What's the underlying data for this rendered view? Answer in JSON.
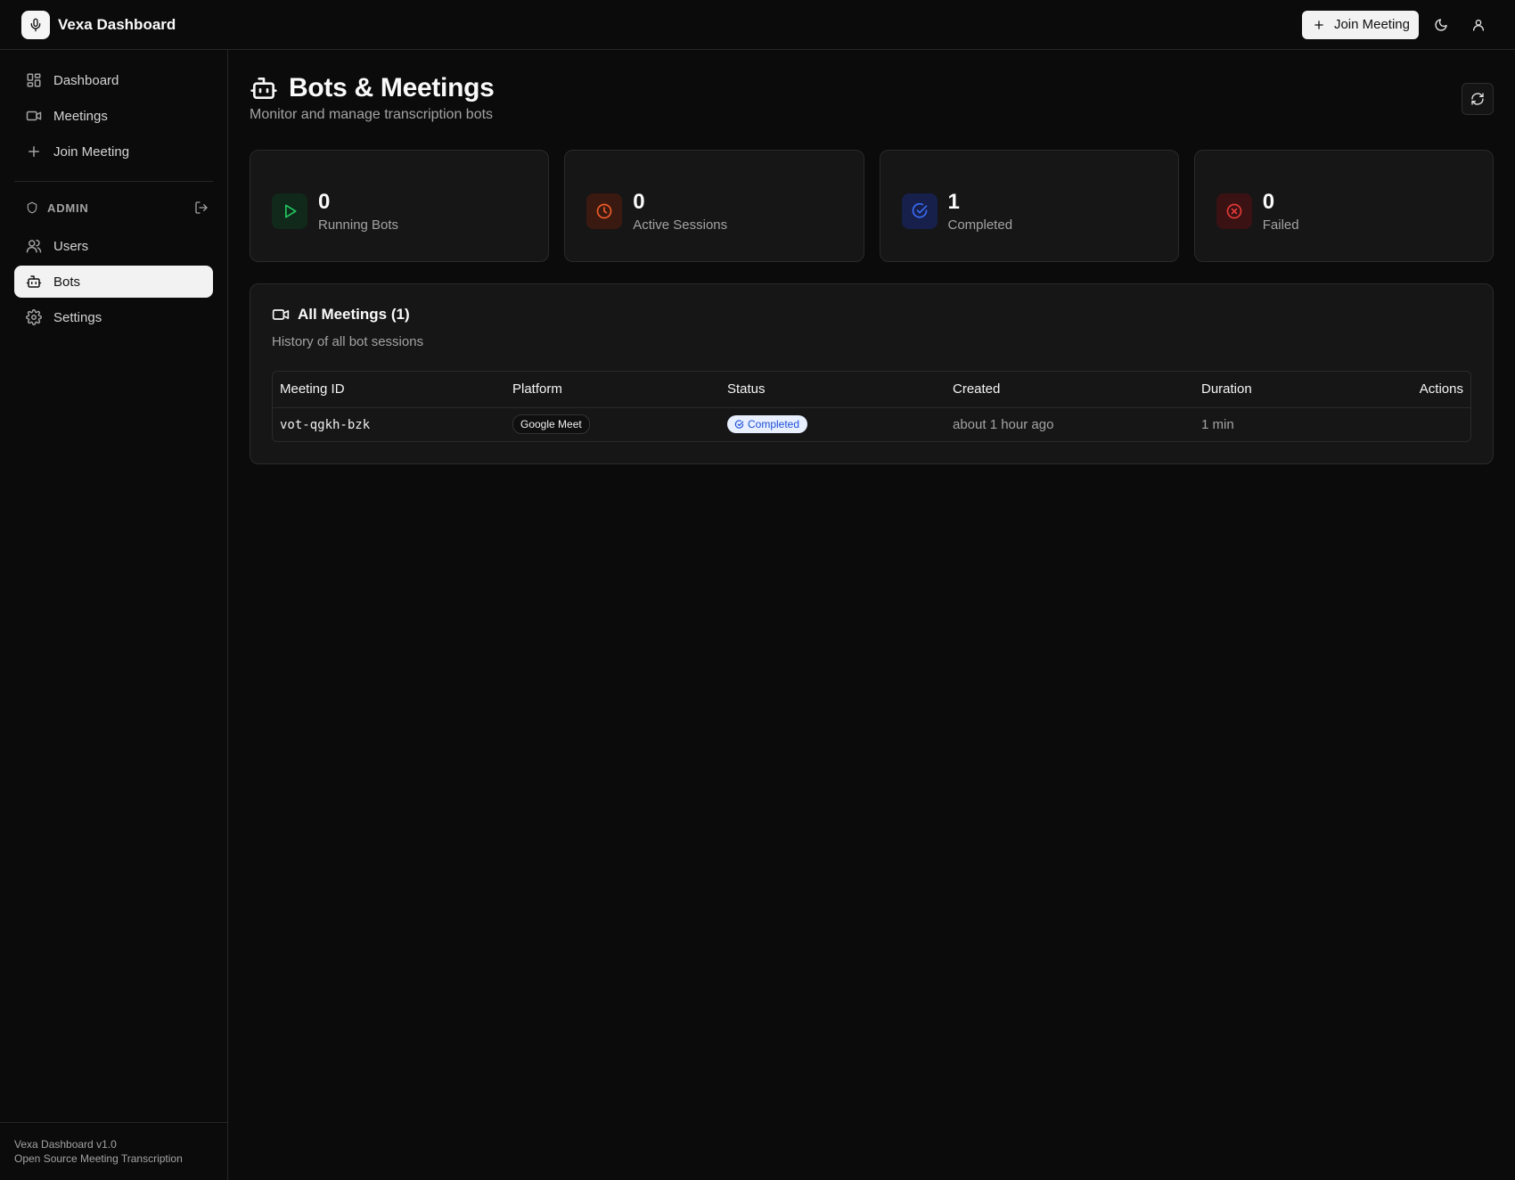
{
  "app": {
    "title": "Vexa Dashboard"
  },
  "header": {
    "join_label": "Join Meeting",
    "theme_icon": "moon-icon",
    "user_icon": "user-icon"
  },
  "sidebar": {
    "items": [
      {
        "label": "Dashboard",
        "icon": "dashboard-icon"
      },
      {
        "label": "Meetings",
        "icon": "video-icon"
      },
      {
        "label": "Join Meeting",
        "icon": "plus-icon"
      }
    ],
    "admin_label": "ADMIN",
    "admin_items": [
      {
        "label": "Users",
        "icon": "users-icon"
      },
      {
        "label": "Bots",
        "icon": "bot-icon",
        "active": true
      },
      {
        "label": "Settings",
        "icon": "gear-icon"
      }
    ],
    "footer_version": "Vexa Dashboard v1.0",
    "footer_tagline": "Open Source Meeting Transcription"
  },
  "page": {
    "title": "Bots & Meetings",
    "subtitle": "Monitor and manage transcription bots"
  },
  "stats": [
    {
      "value": "0",
      "label": "Running Bots",
      "color": "#22c55e"
    },
    {
      "value": "0",
      "label": "Active Sessions",
      "color": "#f05a28"
    },
    {
      "value": "1",
      "label": "Completed",
      "color": "#3b6cf6"
    },
    {
      "value": "0",
      "label": "Failed",
      "color": "#e53935"
    }
  ],
  "meetings": {
    "title": "All Meetings (1)",
    "subtitle": "History of all bot sessions",
    "columns": [
      "Meeting ID",
      "Platform",
      "Status",
      "Created",
      "Duration",
      "Actions"
    ],
    "rows": [
      {
        "meeting_id": "vot-qgkh-bzk",
        "platform": "Google Meet",
        "status": "Completed",
        "created": "about 1 hour ago",
        "duration": "1 min"
      }
    ]
  }
}
